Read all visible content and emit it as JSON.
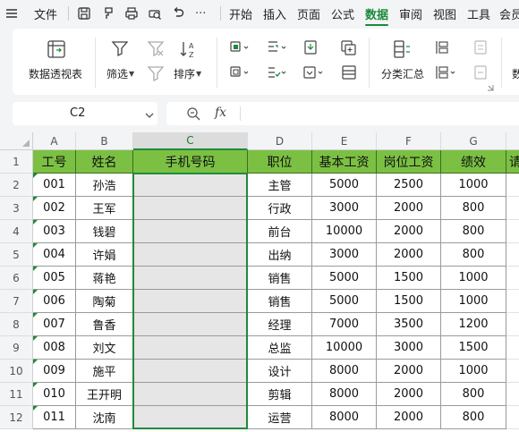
{
  "menubar": {
    "file_label": "文件",
    "more_label": "···",
    "tabs": [
      "开始",
      "插入",
      "页面",
      "公式",
      "数据",
      "审阅",
      "视图",
      "工具",
      "会员"
    ],
    "active_tab": "数据"
  },
  "ribbon": {
    "pivot_label": "数据透视表",
    "filter_label": "筛选",
    "sort_label": "排序",
    "subtotal_label": "分类汇总",
    "cut_label": "数"
  },
  "formula_bar": {
    "cell_ref": "C2",
    "fx_label": "fx",
    "content": ""
  },
  "sheet": {
    "columns": [
      "A",
      "B",
      "C",
      "D",
      "E",
      "F",
      "G"
    ],
    "selected_column": "C",
    "rows": [
      "1",
      "2",
      "3",
      "4",
      "5",
      "6",
      "7",
      "8",
      "9",
      "10",
      "11",
      "12"
    ],
    "headers": [
      "工号",
      "姓名",
      "手机号码",
      "职位",
      "基本工资",
      "岗位工资",
      "绩效",
      "请"
    ],
    "data": [
      [
        "001",
        "孙浩",
        "",
        "主管",
        "5000",
        "2500",
        "1000"
      ],
      [
        "002",
        "王军",
        "",
        "行政",
        "3000",
        "2000",
        "800"
      ],
      [
        "003",
        "钱碧",
        "",
        "前台",
        "10000",
        "2000",
        "800"
      ],
      [
        "004",
        "许娟",
        "",
        "出纳",
        "3000",
        "2000",
        "800"
      ],
      [
        "005",
        "蒋艳",
        "",
        "销售",
        "5000",
        "1500",
        "1000"
      ],
      [
        "006",
        "陶菊",
        "",
        "销售",
        "5000",
        "1500",
        "1000"
      ],
      [
        "007",
        "鲁香",
        "",
        "经理",
        "7000",
        "3500",
        "1200"
      ],
      [
        "008",
        "刘文",
        "",
        "总监",
        "10000",
        "3000",
        "1500"
      ],
      [
        "009",
        "施平",
        "",
        "设计",
        "8000",
        "2000",
        "1000"
      ],
      [
        "010",
        "王开明",
        "",
        "剪辑",
        "8000",
        "2000",
        "800"
      ],
      [
        "011",
        "沈南",
        "",
        "运营",
        "8000",
        "2000",
        "800"
      ]
    ]
  },
  "colors": {
    "accent": "#1a8a3a",
    "header_fill": "#7bc043",
    "selection_fill": "#e6e6e6"
  }
}
